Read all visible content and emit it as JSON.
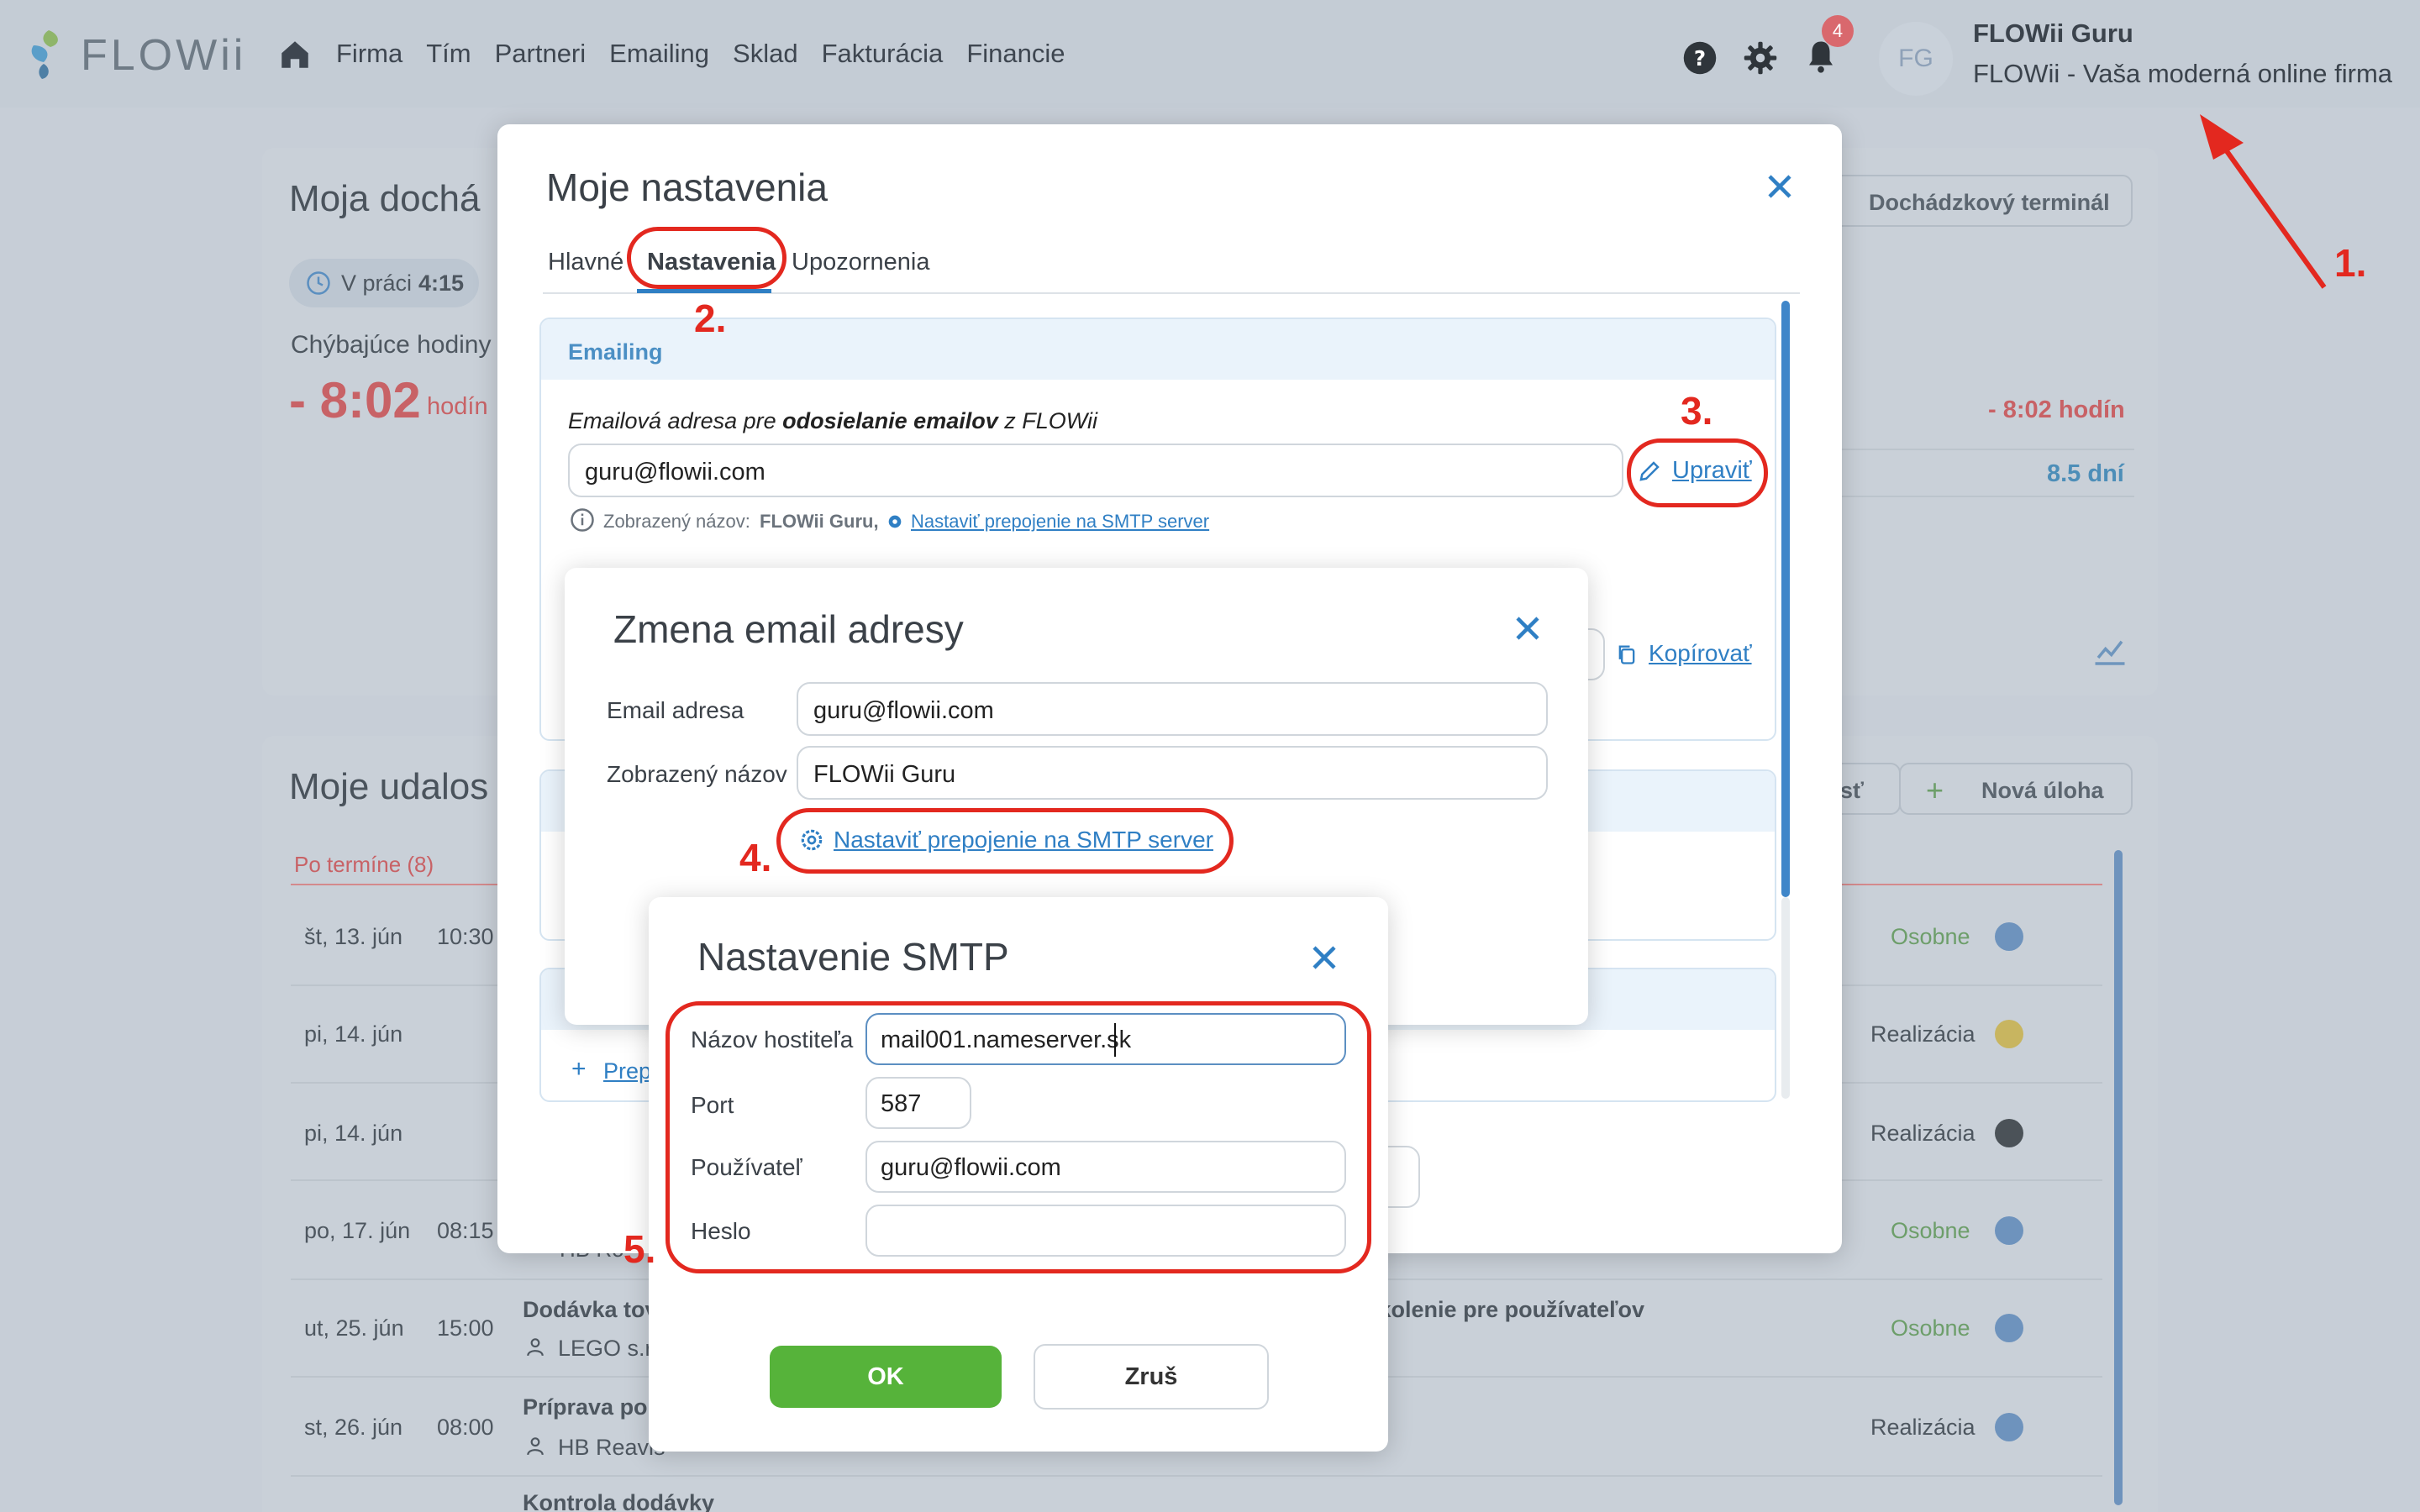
{
  "app": {
    "logo_text": "FLOWii",
    "nav": [
      "Firma",
      "Tím",
      "Partneri",
      "Emailing",
      "Sklad",
      "Fakturácia",
      "Financie"
    ],
    "notification_count": "4",
    "avatar_initials": "FG",
    "user_name": "FLOWii Guru",
    "user_company": "FLOWii - Vaša moderná online firma"
  },
  "background": {
    "attendance_title": "Moja dochá",
    "in_work_label": "V práci",
    "in_work_time": "4:15",
    "missing_hours_label": "Chýbajúce hodiny",
    "missing_hours_value": "- 8:02",
    "missing_hours_unit": "hodín",
    "terminal_button": "Dochádzkový terminál",
    "right_missing": "- 8:02 hodín",
    "right_days": "8.5 dní",
    "copy_link": "Kopírovať",
    "events_title": "Moje udalos",
    "overdue_label": "Po termíne (8)",
    "new_task_button": "Nová úloha",
    "partial_button": "sť",
    "add_partial": "Prep",
    "rows": [
      {
        "date": "št, 13. jún",
        "time": "10:30",
        "title": "",
        "sub": "",
        "status": "Osobne"
      },
      {
        "date": "pi, 14. jún",
        "time": "",
        "title": "",
        "sub": "",
        "status": "Realizácia"
      },
      {
        "date": "pi, 14. jún",
        "time": "",
        "title": "",
        "sub": "",
        "status": "Realizácia"
      },
      {
        "date": "po, 17. jún",
        "time": "08:15",
        "title": "",
        "sub": "HB Ro",
        "status": "Osobne"
      },
      {
        "date": "ut, 25. jún",
        "time": "15:00",
        "title": "Dodávka tov",
        "sub": "LEGO s.r",
        "status": "Osobne"
      },
      {
        "date": "st, 26. jún",
        "time": "08:00",
        "title": "Príprava por",
        "sub": "HB Reavis",
        "status": "Realizácia"
      },
      {
        "date": "",
        "time": "",
        "title": "Kontrola dodávky",
        "sub": "",
        "status": ""
      }
    ],
    "training_text": "e Školenie pre používateľov"
  },
  "settings_dialog": {
    "title": "Moje nastavenia",
    "tabs": [
      "Hlavné",
      "Nastavenia",
      "Upozornenia"
    ],
    "section_emailing": "Emailing",
    "email_label_pre": "Emailová adresa pre ",
    "email_label_bold": "odosielanie emailov",
    "email_label_post": " z FLOWii",
    "email_value": "guru@flowii.com",
    "edit_link": "Upraviť",
    "display_name_label": "Zobrazený názov:",
    "display_name_value": "FLOWii Guru,",
    "smtp_link_small": "Nastaviť prepojenie na SMTP server"
  },
  "change_email_dialog": {
    "title": "Zmena email adresy",
    "email_label": "Email adresa",
    "email_value": "guru@flowii.com",
    "display_label": "Zobrazený názov",
    "display_value": "FLOWii Guru",
    "smtp_link": "Nastaviť prepojenie na SMTP server"
  },
  "smtp_dialog": {
    "title": "Nastavenie SMTP",
    "host_label": "Názov hostiteľa",
    "host_value": "mail001.nameserver.sk",
    "port_label": "Port",
    "port_value": "587",
    "user_label": "Používateľ",
    "user_value": "guru@flowii.com",
    "password_label": "Heslo",
    "password_value": "",
    "ok_button": "OK",
    "cancel_button": "Zruš"
  },
  "annotations": {
    "step1": "1.",
    "step2": "2.",
    "step3": "3.",
    "step4": "4.",
    "step5": "5."
  },
  "colors": {
    "accent_blue": "#2f7fc4",
    "ok_green": "#56b33a",
    "annotation_red": "#e3281f"
  }
}
